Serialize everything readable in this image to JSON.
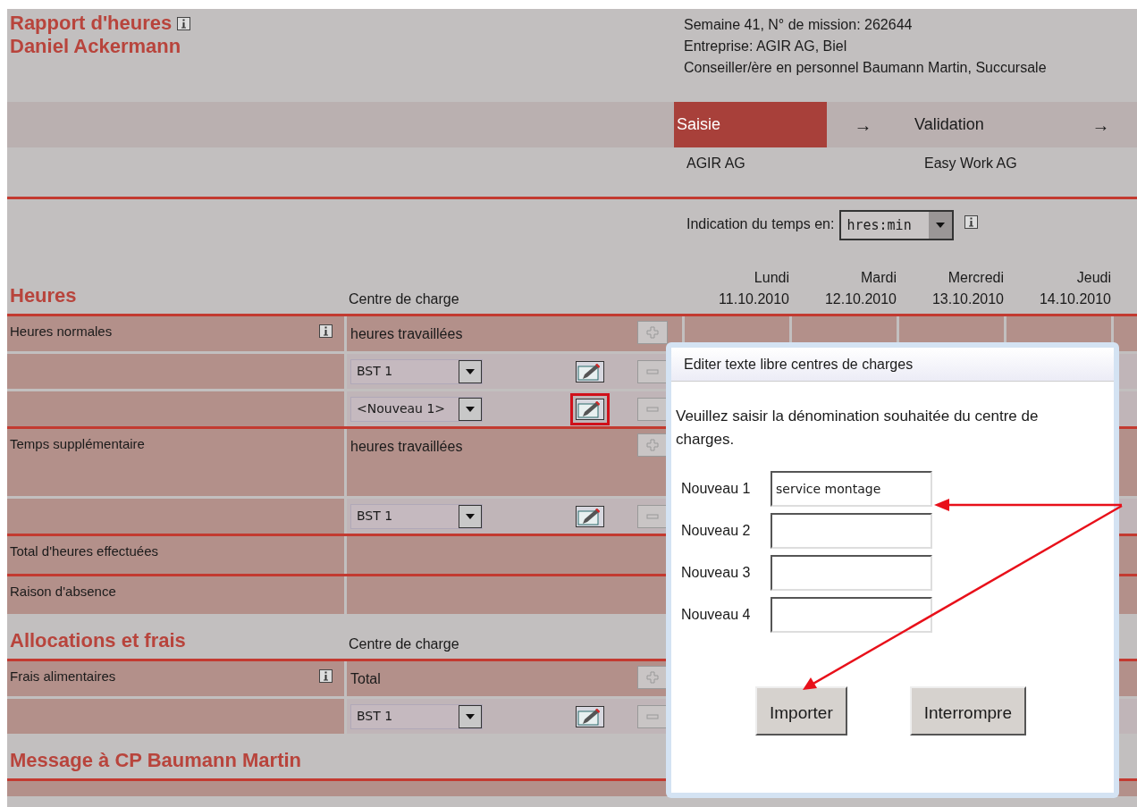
{
  "header": {
    "title": "Rapport d'heures",
    "name": "Daniel Ackermann",
    "info": true,
    "lines": [
      "Semaine 41, N° de mission: 262644",
      "Entreprise: AGIR AG, Biel",
      "Conseiller/ère en personnel Baumann Martin, Succursale"
    ]
  },
  "workflow": [
    {
      "label": "Saisie",
      "arrow": "→",
      "company": "AGIR AG",
      "selected": true
    },
    {
      "label": "Validation",
      "arrow": "→",
      "company": "Easy Work AG",
      "selected": false
    }
  ],
  "time_unit": {
    "label": "Indication du temps en:",
    "value": "hres:min",
    "info": true
  },
  "days": [
    {
      "day": "Lundi",
      "date": "11.10.2010"
    },
    {
      "day": "Mardi",
      "date": "12.10.2010"
    },
    {
      "day": "Mercredi",
      "date": "13.10.2010"
    },
    {
      "day": "Jeudi",
      "date": "14.10.2010"
    }
  ],
  "sections": [
    {
      "title": "Heures",
      "cost_center_header": "Centre de charge",
      "rows": [
        {
          "kind": "main",
          "label": "Heures normales",
          "info": true,
          "cost_center": "heures travaillées",
          "tall": false
        },
        {
          "kind": "sub",
          "select": "BST 1",
          "highlighted": false
        },
        {
          "kind": "sub",
          "select": "<Nouveau 1>",
          "highlighted": true
        },
        {
          "kind": "main",
          "label": "Temps supplémentaire",
          "info": false,
          "cost_center": "heures travaillées",
          "tall": true
        },
        {
          "kind": "sub",
          "select": "BST 1",
          "highlighted": false
        },
        {
          "kind": "total",
          "label": "Total d'heures effectuées"
        },
        {
          "kind": "total",
          "label": "Raison d'absence"
        }
      ]
    },
    {
      "title": "Allocations et frais",
      "cost_center_header": "Centre de charge",
      "rows": [
        {
          "kind": "main",
          "label": "Frais alimentaires",
          "info": true,
          "cost_center": "Total",
          "tall": false
        },
        {
          "kind": "sub",
          "select": "BST 1",
          "highlighted": false
        }
      ]
    },
    {
      "title": "Message à CP Baumann Martin",
      "rows": [
        {
          "kind": "cut"
        }
      ]
    }
  ],
  "dialog": {
    "title": "Editer texte libre centres de charges",
    "text": "Veuillez saisir la dénomination souhaitée du centre de charges.",
    "fields": [
      {
        "label": "Nouveau 1",
        "value": "service montage"
      },
      {
        "label": "Nouveau 2"
      },
      {
        "label": "Nouveau 3"
      },
      {
        "label": "Nouveau 4"
      }
    ],
    "buttons": [
      "Importer",
      "Interrompre"
    ]
  }
}
